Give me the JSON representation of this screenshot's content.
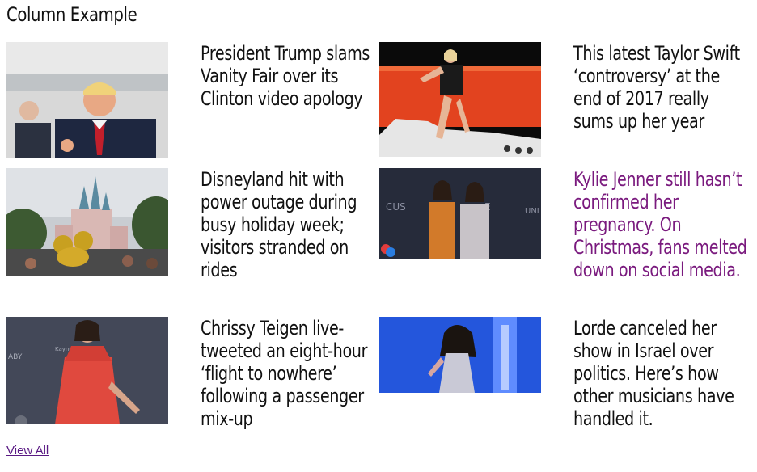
{
  "section": {
    "title": "Column Example",
    "view_all_label": "View All"
  },
  "articles": [
    {
      "headline": "President Trump slams Vanity Fair over its Clinton video apology",
      "image": "trump-photo",
      "visited": false
    },
    {
      "headline": "This latest Taylor Swift ‘controversy’ at the end of 2017 really sums up her year",
      "image": "taylor-swift-photo",
      "visited": false
    },
    {
      "headline": "Disneyland hit with power outage during busy holiday week; visitors stranded on rides",
      "image": "disneyland-castle-photo",
      "visited": false
    },
    {
      "headline": "Kylie Jenner still hasn’t confirmed her pregnancy. On Christmas, fans melted down on social media.",
      "image": "kylie-kendall-jenner-photo",
      "visited": true
    },
    {
      "headline": "Chrissy Teigen live-tweeted an eight-hour ‘flight to nowhere’ following a passenger mix-up",
      "image": "chrissy-teigen-photo",
      "visited": false
    },
    {
      "headline": "Lorde canceled her show in Israel over politics. Here’s how other musicians have handled it.",
      "image": "lorde-concert-photo",
      "visited": false
    }
  ],
  "colors": {
    "text": "#111111",
    "visited_link": "#7a1a7e",
    "view_all_link": "#5a1a84"
  }
}
